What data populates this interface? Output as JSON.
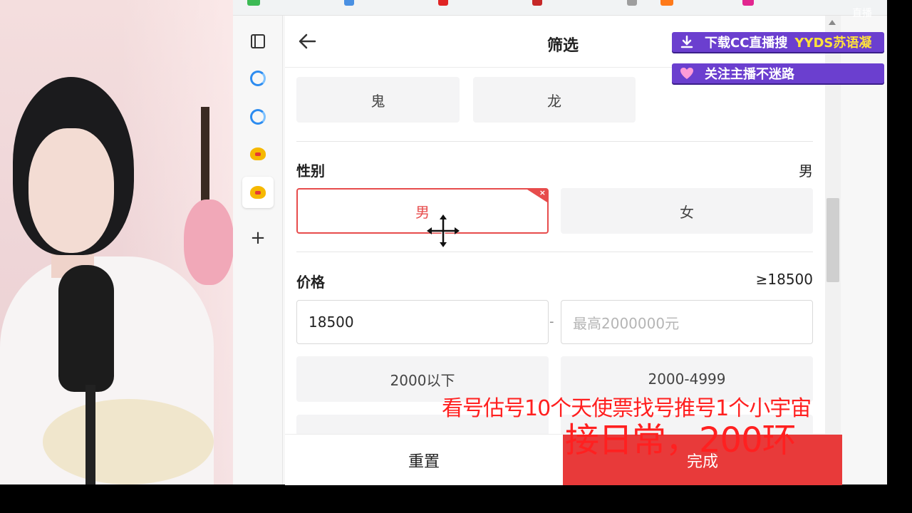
{
  "overlay": {
    "logo_text": "直播",
    "banner_download_text": "下载CC直播搜",
    "banner_download_highlight": "YYDS苏语凝",
    "banner_follow_text": "关注主播不迷路",
    "promo_line1": "看号估号10个天使票找号推号1个小宇宙",
    "promo_line2": "接日常，200环"
  },
  "panel": {
    "title": "筛选",
    "back_icon": "arrow-left-icon",
    "top_chips": [
      "鬼",
      "龙"
    ],
    "gender": {
      "title": "性别",
      "selected_value": "男",
      "options": [
        {
          "label": "男",
          "selected": true
        },
        {
          "label": "女",
          "selected": false
        }
      ]
    },
    "price": {
      "title": "价格",
      "summary": "≥18500",
      "min_value": "18500",
      "separator": "-",
      "max_placeholder": "最高2000000元",
      "ranges": [
        "2000以下",
        "2000-4999"
      ]
    },
    "footer": {
      "reset_label": "重置",
      "done_label": "完成"
    }
  },
  "colors": {
    "accent_red": "#e83a3a",
    "banner_purple": "#6b3fcf",
    "overlay_red": "#ff2020"
  }
}
